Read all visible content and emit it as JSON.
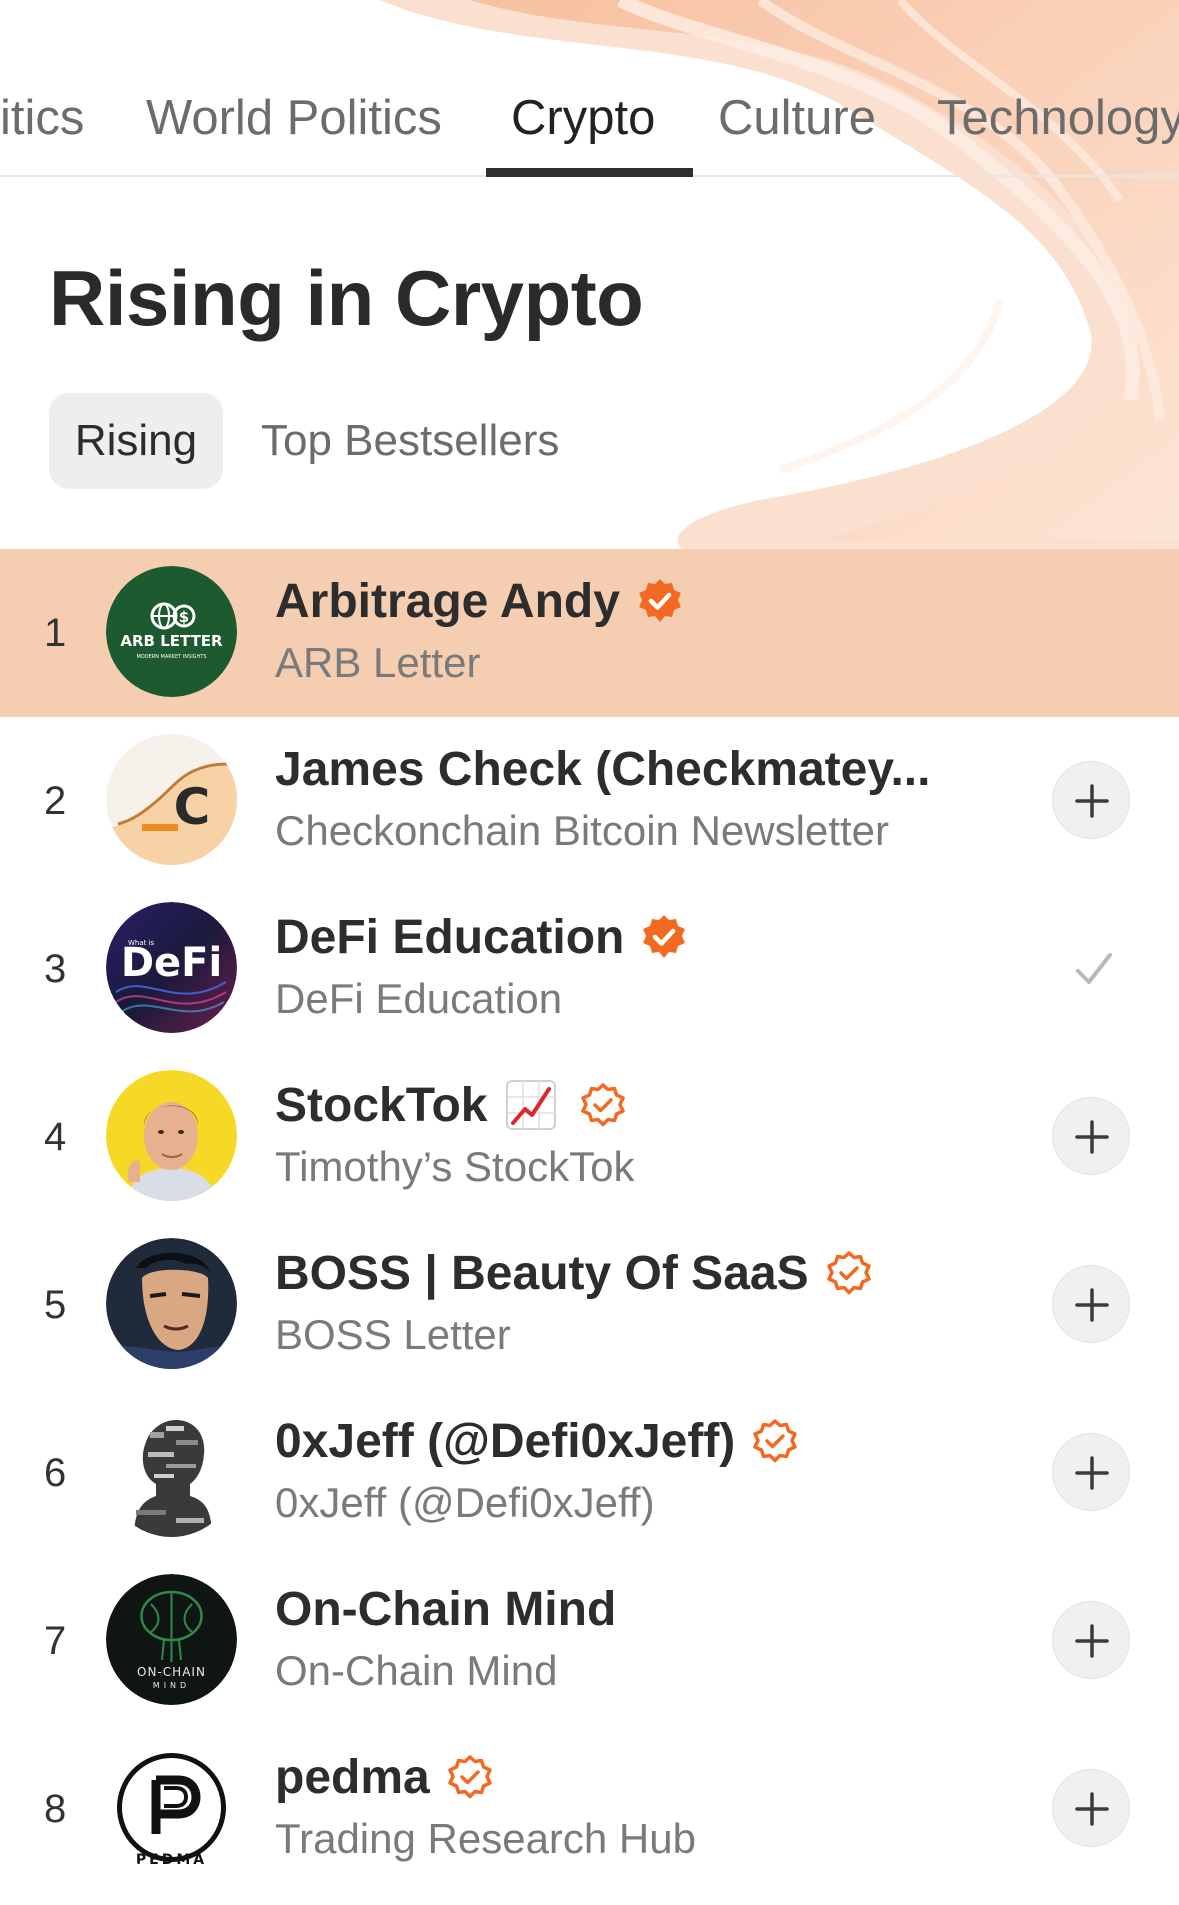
{
  "colors": {
    "accent": "#f26a21",
    "highlight_row": "#f5cdb0",
    "swirl": "#f7c8a8"
  },
  "category_tabs": [
    {
      "label": "itics"
    },
    {
      "label": "World Politics"
    },
    {
      "label": "Crypto",
      "active": true
    },
    {
      "label": "Culture"
    },
    {
      "label": "Technology"
    }
  ],
  "page_title": "Rising in Crypto",
  "sub_tabs": [
    {
      "label": "Rising",
      "active": true
    },
    {
      "label": "Top Bestsellers"
    }
  ],
  "list": [
    {
      "rank": "1",
      "name": "Arbitrage Andy",
      "subtitle": "ARB Letter",
      "badge": "verified-filled-icon",
      "action": "none",
      "avatar": "arb-letter-logo",
      "avatar_text": "ARB LETTER",
      "avatar_subtext": "MODERN MARKET INSIGHTS"
    },
    {
      "rank": "2",
      "name": "James Check (Checkmatey...",
      "subtitle": "Checkonchain Bitcoin Newsletter",
      "badge": "none",
      "action": "add",
      "avatar": "checkonchain-logo",
      "avatar_text": "C"
    },
    {
      "rank": "3",
      "name": "DeFi Education",
      "subtitle": "DeFi Education",
      "badge": "verified-filled-icon",
      "action": "subscribed",
      "avatar": "defi-logo",
      "avatar_text": "DeFi",
      "avatar_subtext": "What is"
    },
    {
      "rank": "4",
      "name": "StockTok",
      "subtitle": "Timothy’s StockTok",
      "badge": "verified-outline-icon",
      "emoji": "chart-increasing-icon",
      "action": "add",
      "avatar": "person-photo"
    },
    {
      "rank": "5",
      "name": "BOSS | Beauty Of SaaS",
      "subtitle": "BOSS Letter",
      "badge": "verified-outline-icon",
      "action": "add",
      "avatar": "comic-hero-illustration"
    },
    {
      "rank": "6",
      "name": "0xJeff (@Defi0xJeff)",
      "subtitle": "0xJeff (@Defi0xJeff)",
      "badge": "verified-outline-icon",
      "action": "add",
      "avatar": "glitch-portrait"
    },
    {
      "rank": "7",
      "name": "On-Chain Mind",
      "subtitle": "On-Chain Mind",
      "badge": "none",
      "action": "add",
      "avatar": "on-chain-mind-logo",
      "avatar_text": "ON-CHAIN",
      "avatar_subtext": "MIND"
    },
    {
      "rank": "8",
      "name": "pedma",
      "subtitle": "Trading Research Hub",
      "badge": "verified-outline-icon",
      "action": "add",
      "avatar": "pedma-logo",
      "avatar_text": "PEDMA"
    }
  ]
}
